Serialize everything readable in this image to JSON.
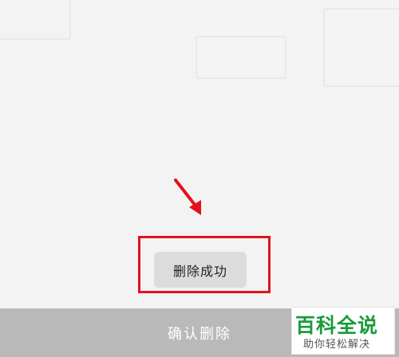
{
  "toast": {
    "message": "删除成功"
  },
  "bottom_bar": {
    "confirm_label": "确认删除"
  },
  "watermark": {
    "main": "百科全说",
    "sub": "助你轻松解决"
  },
  "colors": {
    "highlight": "#e4121b",
    "watermark_green": "#1a9a3a",
    "bottom_bar": "#b9b9b9",
    "toast_bg": "#dcdcdc"
  }
}
